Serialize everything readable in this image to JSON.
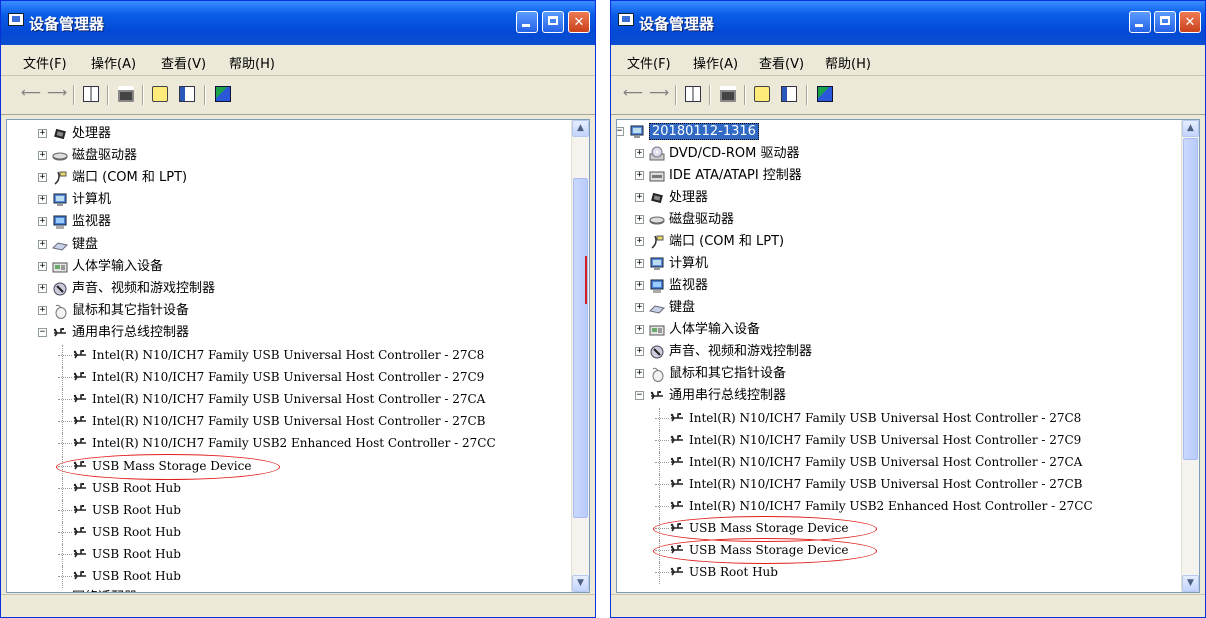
{
  "windows": [
    {
      "title": "设备管理器",
      "menu": [
        "文件(F)",
        "操作(A)",
        "查看(V)",
        "帮助(H)"
      ],
      "tree": [
        {
          "label": "处理器",
          "level": 1,
          "expander": "+",
          "icon": "cpu-icon"
        },
        {
          "label": "磁盘驱动器",
          "level": 1,
          "expander": "+",
          "icon": "disk-drive-icon"
        },
        {
          "label": "端口 (COM 和 LPT)",
          "level": 1,
          "expander": "+",
          "icon": "port-icon"
        },
        {
          "label": "计算机",
          "level": 1,
          "expander": "+",
          "icon": "computer-icon"
        },
        {
          "label": "监视器",
          "level": 1,
          "expander": "+",
          "icon": "monitor-icon"
        },
        {
          "label": "键盘",
          "level": 1,
          "expander": "+",
          "icon": "keyboard-icon"
        },
        {
          "label": "人体学输入设备",
          "level": 1,
          "expander": "+",
          "icon": "hid-icon"
        },
        {
          "label": "声音、视频和游戏控制器",
          "level": 1,
          "expander": "+",
          "icon": "sound-icon"
        },
        {
          "label": "鼠标和其它指针设备",
          "level": 1,
          "expander": "+",
          "icon": "mouse-icon"
        },
        {
          "label": "通用串行总线控制器",
          "level": 1,
          "expander": "-",
          "icon": "usb-icon"
        },
        {
          "label": "Intel(R) N10/ICH7 Family USB Universal Host Controller - 27C8",
          "level": 2,
          "icon": "usb-icon"
        },
        {
          "label": "Intel(R) N10/ICH7 Family USB Universal Host Controller - 27C9",
          "level": 2,
          "icon": "usb-icon"
        },
        {
          "label": "Intel(R) N10/ICH7 Family USB Universal Host Controller - 27CA",
          "level": 2,
          "icon": "usb-icon"
        },
        {
          "label": "Intel(R) N10/ICH7 Family USB Universal Host Controller - 27CB",
          "level": 2,
          "icon": "usb-icon"
        },
        {
          "label": "Intel(R) N10/ICH7 Family USB2 Enhanced Host Controller - 27CC",
          "level": 2,
          "icon": "usb-icon"
        },
        {
          "label": "USB Mass Storage Device",
          "level": 2,
          "icon": "usb-icon",
          "circled": true
        },
        {
          "label": "USB Root Hub",
          "level": 2,
          "icon": "usb-icon"
        },
        {
          "label": "USB Root Hub",
          "level": 2,
          "icon": "usb-icon"
        },
        {
          "label": "USB Root Hub",
          "level": 2,
          "icon": "usb-icon"
        },
        {
          "label": "USB Root Hub",
          "level": 2,
          "icon": "usb-icon"
        },
        {
          "label": "USB Root Hub",
          "level": 2,
          "icon": "usb-icon"
        },
        {
          "label": "网络适配器",
          "level": 1,
          "expander": "+",
          "icon": "network-icon"
        }
      ]
    },
    {
      "title": "设备管理器",
      "menu": [
        "文件(F)",
        "操作(A)",
        "查看(V)",
        "帮助(H)"
      ],
      "tree": [
        {
          "label": "20180112-1316",
          "level": 0,
          "expander": "-",
          "icon": "computer-icon",
          "selected": true
        },
        {
          "label": "DVD/CD-ROM 驱动器",
          "level": 1,
          "expander": "+",
          "icon": "cdrom-icon"
        },
        {
          "label": "IDE ATA/ATAPI 控制器",
          "level": 1,
          "expander": "+",
          "icon": "ide-icon"
        },
        {
          "label": "处理器",
          "level": 1,
          "expander": "+",
          "icon": "cpu-icon"
        },
        {
          "label": "磁盘驱动器",
          "level": 1,
          "expander": "+",
          "icon": "disk-drive-icon"
        },
        {
          "label": "端口 (COM 和 LPT)",
          "level": 1,
          "expander": "+",
          "icon": "port-icon"
        },
        {
          "label": "计算机",
          "level": 1,
          "expander": "+",
          "icon": "computer-icon"
        },
        {
          "label": "监视器",
          "level": 1,
          "expander": "+",
          "icon": "monitor-icon"
        },
        {
          "label": "键盘",
          "level": 1,
          "expander": "+",
          "icon": "keyboard-icon"
        },
        {
          "label": "人体学输入设备",
          "level": 1,
          "expander": "+",
          "icon": "hid-icon"
        },
        {
          "label": "声音、视频和游戏控制器",
          "level": 1,
          "expander": "+",
          "icon": "sound-icon"
        },
        {
          "label": "鼠标和其它指针设备",
          "level": 1,
          "expander": "+",
          "icon": "mouse-icon"
        },
        {
          "label": "通用串行总线控制器",
          "level": 1,
          "expander": "-",
          "icon": "usb-icon"
        },
        {
          "label": "Intel(R) N10/ICH7 Family USB Universal Host Controller - 27C8",
          "level": 2,
          "icon": "usb-icon"
        },
        {
          "label": "Intel(R) N10/ICH7 Family USB Universal Host Controller - 27C9",
          "level": 2,
          "icon": "usb-icon"
        },
        {
          "label": "Intel(R) N10/ICH7 Family USB Universal Host Controller - 27CA",
          "level": 2,
          "icon": "usb-icon"
        },
        {
          "label": "Intel(R) N10/ICH7 Family USB Universal Host Controller - 27CB",
          "level": 2,
          "icon": "usb-icon"
        },
        {
          "label": "Intel(R) N10/ICH7 Family USB2 Enhanced Host Controller - 27CC",
          "level": 2,
          "icon": "usb-icon"
        },
        {
          "label": "USB Mass Storage Device",
          "level": 2,
          "icon": "usb-icon",
          "circled": true
        },
        {
          "label": "USB Mass Storage Device",
          "level": 2,
          "icon": "usb-icon",
          "circled": true
        },
        {
          "label": "USB Root Hub",
          "level": 2,
          "icon": "usb-icon"
        }
      ]
    }
  ],
  "colors": {
    "title_bar": "#0a5ee8",
    "annotation": "#e0201c",
    "selection": "#316ac5",
    "window_face": "#ECE9D8"
  }
}
